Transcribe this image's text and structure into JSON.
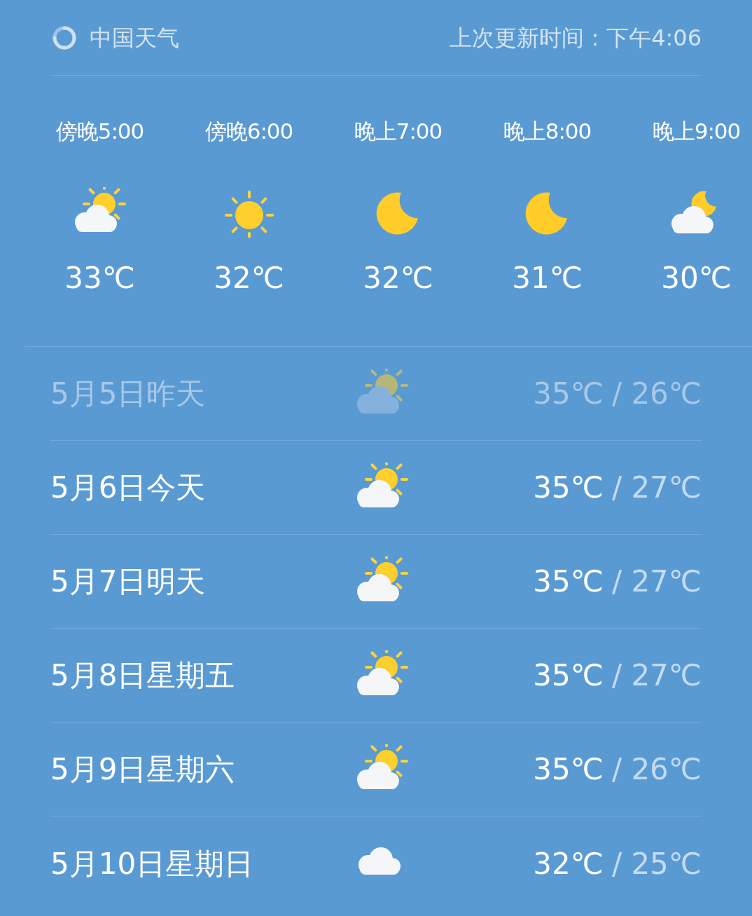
{
  "header": {
    "brand": "中国天气",
    "updated": "上次更新时间：下午4:06"
  },
  "hourly": [
    {
      "time": "傍晚5:00",
      "kind": "partly_cloudy",
      "temp": "33℃"
    },
    {
      "time": "傍晚6:00",
      "kind": "sunny",
      "temp": "32℃"
    },
    {
      "time": "晚上7:00",
      "kind": "moon",
      "temp": "32℃"
    },
    {
      "time": "晚上8:00",
      "kind": "moon",
      "temp": "31℃"
    },
    {
      "time": "晚上9:00",
      "kind": "cloudy_night",
      "temp": "30℃"
    }
  ],
  "daily": [
    {
      "date": "5月5日昨天",
      "kind": "partly_cloudy",
      "high": "35℃",
      "low": "/ 26℃",
      "past": true
    },
    {
      "date": "5月6日今天",
      "kind": "partly_cloudy",
      "high": "35℃",
      "low": "/ 27℃",
      "past": false
    },
    {
      "date": "5月7日明天",
      "kind": "partly_cloudy",
      "high": "35℃",
      "low": "/ 27℃",
      "past": false
    },
    {
      "date": "5月8日星期五",
      "kind": "partly_cloudy",
      "high": "35℃",
      "low": "/ 27℃",
      "past": false
    },
    {
      "date": "5月9日星期六",
      "kind": "partly_cloudy",
      "high": "35℃",
      "low": "/ 26℃",
      "past": false
    },
    {
      "date": "5月10日星期日",
      "kind": "cloudy",
      "high": "32℃",
      "low": "/ 25℃",
      "past": false
    }
  ]
}
